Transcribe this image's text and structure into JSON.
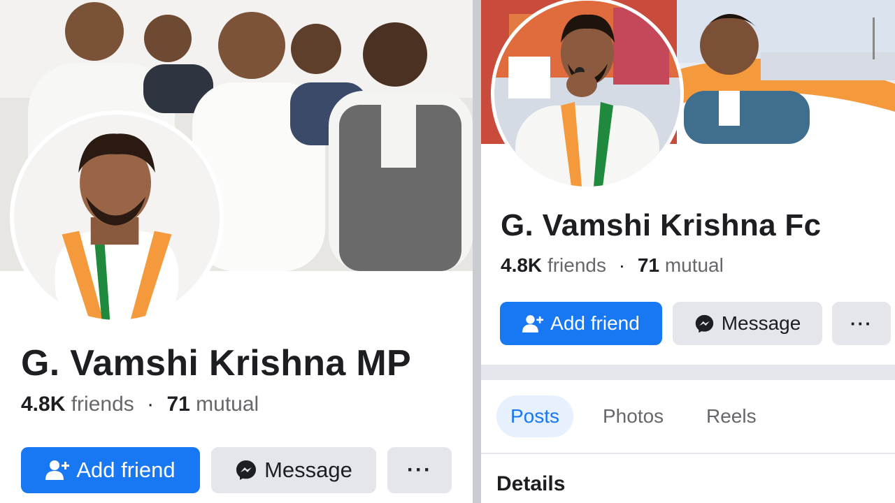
{
  "left_profile": {
    "name": "G. Vamshi Krishna MP",
    "friends_count": "4.8K",
    "friends_label": "friends",
    "mutual_count": "71",
    "mutual_label": "mutual",
    "separator": "·",
    "add_friend_label": "Add friend",
    "message_label": "Message",
    "more_label": "···"
  },
  "right_profile": {
    "name": "G. Vamshi Krishna Fc",
    "friends_count": "4.8K",
    "friends_label": "friends",
    "mutual_count": "71",
    "mutual_label": "mutual",
    "separator": "·",
    "add_friend_label": "Add friend",
    "message_label": "Message",
    "more_label": "···",
    "tabs": [
      {
        "label": "Posts",
        "active": true
      },
      {
        "label": "Photos",
        "active": false
      },
      {
        "label": "Reels",
        "active": false
      }
    ],
    "details_heading": "Details"
  },
  "icons": {
    "add_friend": "add-person-icon",
    "message": "messenger-icon"
  },
  "colors": {
    "primary_button": "#1877f2",
    "secondary_button": "#e4e6eb",
    "active_tab_bg": "#e7f0fd",
    "text_primary": "#1c1e21",
    "text_secondary": "#65676b"
  }
}
